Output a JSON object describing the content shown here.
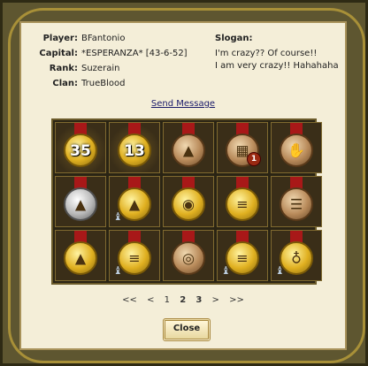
{
  "profile": {
    "player_label": "Player:",
    "player": "BFantonio",
    "capital_label": "Capital:",
    "capital": "*ESPERANZA* [43-6-52]",
    "rank_label": "Rank:",
    "rank": "Suzerain",
    "clan_label": "Clan:",
    "clan": "TrueBlood",
    "slogan_label": "Slogan:",
    "slogan_line1": "I'm crazy?? Of course!!",
    "slogan_line2": "I am very crazy!! Hahahaha"
  },
  "send_message": "Send Message",
  "medals": [
    {
      "metal": "gold",
      "icon": "laurel-icon",
      "text": "35",
      "shiny": true
    },
    {
      "metal": "gold",
      "icon": "laurel-icon",
      "text": "13",
      "shiny": true
    },
    {
      "metal": "bronze",
      "icon": "sack-icon",
      "text": ""
    },
    {
      "metal": "bronze",
      "icon": "map-icon",
      "text": "",
      "badge": "1"
    },
    {
      "metal": "bronze",
      "icon": "hands-icon",
      "text": ""
    },
    {
      "metal": "silver",
      "icon": "sack-icon",
      "text": ""
    },
    {
      "metal": "gold",
      "icon": "sack-icon",
      "text": "",
      "wizard": true
    },
    {
      "metal": "gold",
      "icon": "eye-icon",
      "text": ""
    },
    {
      "metal": "gold",
      "icon": "scroll-icon",
      "text": ""
    },
    {
      "metal": "bronze",
      "icon": "totem-icon",
      "text": ""
    },
    {
      "metal": "gold",
      "icon": "sack-icon",
      "text": ""
    },
    {
      "metal": "gold",
      "icon": "scroll-icon",
      "text": "",
      "wizard": true
    },
    {
      "metal": "bronze",
      "icon": "coins-icon",
      "text": ""
    },
    {
      "metal": "gold",
      "icon": "scroll-icon",
      "text": "",
      "wizard": true
    },
    {
      "metal": "gold",
      "icon": "vase-icon",
      "text": "",
      "wizard": true
    }
  ],
  "pager": {
    "first": "<<",
    "prev": "<",
    "pages": [
      "1",
      "2",
      "3"
    ],
    "next": ">",
    "last": ">>"
  },
  "close_label": "Close"
}
